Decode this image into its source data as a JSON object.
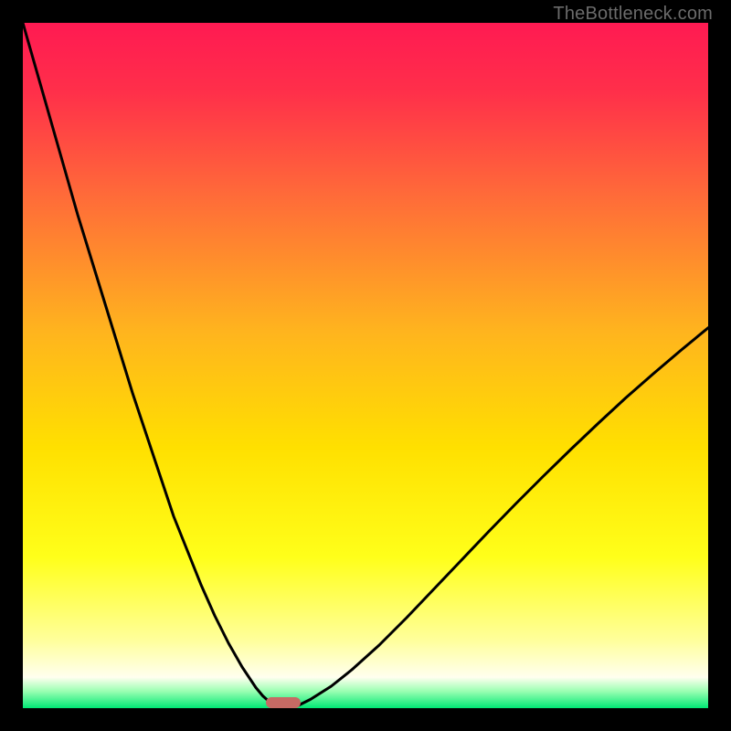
{
  "watermark": "TheBottleneck.com",
  "colors": {
    "frame": "#000000",
    "gradient_stops": [
      {
        "pos": 0.0,
        "color": "#ff1a52"
      },
      {
        "pos": 0.1,
        "color": "#ff2f4a"
      },
      {
        "pos": 0.25,
        "color": "#ff6a39"
      },
      {
        "pos": 0.45,
        "color": "#ffb41e"
      },
      {
        "pos": 0.62,
        "color": "#ffe000"
      },
      {
        "pos": 0.78,
        "color": "#ffff1a"
      },
      {
        "pos": 0.9,
        "color": "#ffff9a"
      },
      {
        "pos": 0.955,
        "color": "#ffffef"
      },
      {
        "pos": 0.975,
        "color": "#9cffb3"
      },
      {
        "pos": 1.0,
        "color": "#00e874"
      }
    ],
    "curve": "#000000",
    "marker": "#c76a64"
  },
  "chart_data": {
    "type": "line",
    "title": "",
    "xlabel": "",
    "ylabel": "",
    "xlim": [
      0,
      100
    ],
    "ylim": [
      0,
      100
    ],
    "x": [
      0,
      2,
      4,
      6,
      8,
      10,
      12,
      14,
      16,
      18,
      20,
      22,
      24,
      26,
      28,
      30,
      32,
      34,
      35,
      36,
      37,
      38,
      40,
      42,
      45,
      48,
      52,
      56,
      60,
      64,
      68,
      72,
      76,
      80,
      84,
      88,
      92,
      96,
      100
    ],
    "values": [
      100,
      93,
      86,
      79,
      72,
      65.5,
      59,
      52.5,
      46,
      40,
      34,
      28,
      23,
      18,
      13.5,
      9.5,
      6,
      3,
      1.8,
      0.9,
      0.3,
      0,
      0.3,
      1.3,
      3.2,
      5.6,
      9.2,
      13.2,
      17.4,
      21.6,
      25.8,
      29.9,
      33.9,
      37.8,
      41.6,
      45.3,
      48.8,
      52.2,
      55.5
    ],
    "note": "Black curve representing bottleneck percentage; minimum (0) at x≈38."
  },
  "marker": {
    "x_center_pct": 38,
    "width_pct": 5
  }
}
